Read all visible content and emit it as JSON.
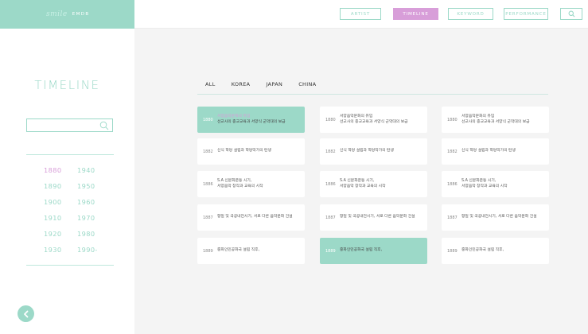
{
  "brand": {
    "mark": "smile",
    "name": "EMDB"
  },
  "nav": [
    {
      "label": "ARTIST",
      "active": false
    },
    {
      "label": "TIMELINE",
      "active": true
    },
    {
      "label": "KEYWORD",
      "active": false
    },
    {
      "label": "PERFORMANCE",
      "active": false
    }
  ],
  "sidebar": {
    "title": "TIMELINE",
    "search_value": "",
    "years_left": [
      "1880",
      "1890",
      "1900",
      "1910",
      "1920",
      "1930"
    ],
    "years_right": [
      "1940",
      "1950",
      "1960",
      "1970",
      "1980",
      "1990-"
    ],
    "active_year": "1880"
  },
  "tabs": [
    "ALL",
    "KOREA",
    "JAPAN",
    "CHINA"
  ],
  "columns": [
    [
      {
        "year": "1880",
        "line1": "서양음악문화의 유입",
        "line2": "선교사의 종교교육과 서양식 군악대의 보급",
        "active": true,
        "highlight_first": true
      },
      {
        "year": "1882",
        "line1": "신식 학당 설립과 학당악가의 탄생",
        "line2": "",
        "active": false
      },
      {
        "year": "1886",
        "line1": "S.A 신문화운동 시기,",
        "line2": "서양음악 창작과 교육의 시작",
        "active": false
      },
      {
        "year": "1887",
        "line1": "항일 및 국공내전시기, 서로 다른 음악문화 건설",
        "line2": "",
        "active": false
      },
      {
        "year": "1889",
        "line1": "중화인민공화국 설립 직후,",
        "line2": "",
        "active": false
      }
    ],
    [
      {
        "year": "1880",
        "line1": "서양음악문화의 유입",
        "line2": "선교사의 종교교육과 서양식 군악대의 보급",
        "active": false
      },
      {
        "year": "1882",
        "line1": "신식 학당 설립과 학당악가의 탄생",
        "line2": "",
        "active": false
      },
      {
        "year": "1886",
        "line1": "S.A 신문화운동 시기,",
        "line2": "서양음악 창작과 교육의 시작",
        "active": false
      },
      {
        "year": "1887",
        "line1": "항일 및 국공내전시기, 서로 다른 음악문화 건설",
        "line2": "",
        "active": false
      },
      {
        "year": "1889",
        "line1": "중화인민공화국 설립 직후,",
        "line2": "",
        "active": true
      }
    ],
    [
      {
        "year": "1880",
        "line1": "서양음악문화의 유입",
        "line2": "선교사의 종교교육과 서양식 군악대의 보급",
        "active": false
      },
      {
        "year": "1882",
        "line1": "신식 학당 설립과 학당악가의 탄생",
        "line2": "",
        "active": false
      },
      {
        "year": "1886",
        "line1": "S.A 신문화운동 시기,",
        "line2": "서양음악 창작과 교육의 시작",
        "active": false
      },
      {
        "year": "1887",
        "line1": "항일 및 국공내전시기, 서로 다른 음악문화 건설",
        "line2": "",
        "active": false
      },
      {
        "year": "1889",
        "line1": "중화인민공화국 설립 직후,",
        "line2": "",
        "active": false
      }
    ]
  ],
  "icons": {
    "search": "search-icon",
    "back": "chevron-left-icon"
  },
  "colors": {
    "mint": "#9cd9c8",
    "pink": "#d89ed9"
  }
}
